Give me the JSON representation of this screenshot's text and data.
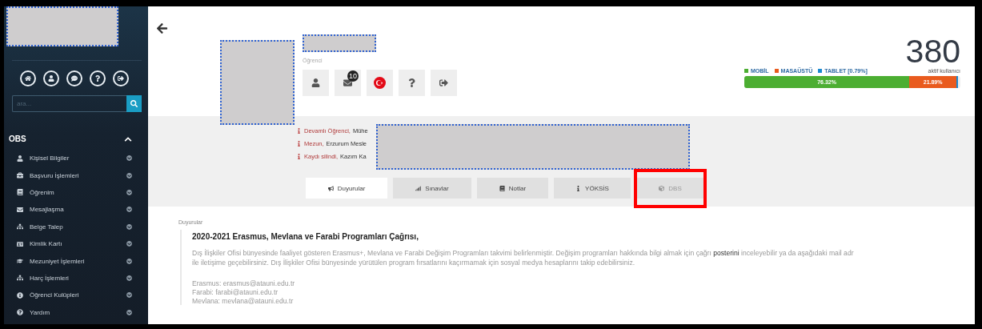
{
  "sidebar": {
    "quick_icons": [
      {
        "kind": "home"
      },
      {
        "kind": "user"
      },
      {
        "kind": "chat"
      },
      {
        "kind": "help"
      },
      {
        "kind": "logout"
      }
    ],
    "search": {
      "placeholder": "ara..."
    },
    "section": {
      "title": "OBS",
      "expanded": true
    },
    "items": [
      {
        "label": "Kişisel Bilgiler",
        "kind": "user"
      },
      {
        "label": "Başvuru İşlemleri",
        "kind": "briefcase"
      },
      {
        "label": "Öğrenim",
        "kind": "book"
      },
      {
        "label": "Mesajlaşma",
        "kind": "envelope"
      },
      {
        "label": "Belge Talep",
        "kind": "sitemap"
      },
      {
        "label": "Kimlik Kartı",
        "kind": "card"
      },
      {
        "label": "Mezuniyet İşlemleri",
        "kind": "cap"
      },
      {
        "label": "Harç İşlemleri",
        "kind": "sitemap"
      },
      {
        "label": "Öğrenci Kulüpleri",
        "kind": "info"
      },
      {
        "label": "Yardım",
        "kind": "help"
      }
    ]
  },
  "profile": {
    "role": "Öğrenci",
    "actions": [
      {
        "kind": "user"
      },
      {
        "kind": "mail",
        "badge": "10"
      },
      {
        "kind": "flag"
      },
      {
        "kind": "help"
      },
      {
        "kind": "logout"
      }
    ],
    "statuses": [
      {
        "status": "Devamlı Öğrenci,",
        "detail": "Mühe"
      },
      {
        "status": "Mezun,",
        "detail": "Erzurum Mesle"
      },
      {
        "status": "Kaydı silindi,",
        "detail": "Kazım Ka"
      }
    ]
  },
  "active_users": {
    "count": "380",
    "label": "aktif kullanıcı",
    "segments": [
      {
        "name": "MOBİL",
        "color": "#4cae32",
        "level": 0.7632,
        "reading": "76.32%"
      },
      {
        "name": "MASAÜSTÜ",
        "color": "#e95b1e",
        "level": 0.2189,
        "reading": "21.89%"
      },
      {
        "name": "TABLET [0.79%]",
        "color": "#1b8ad0",
        "level": 0.0079
      }
    ]
  },
  "tabs": [
    {
      "label": "Duyurular",
      "kind": "bullhorn",
      "selected": true,
      "disabled": false,
      "highlighted": false
    },
    {
      "label": "Sınavlar",
      "kind": "chart",
      "selected": false,
      "disabled": false,
      "highlighted": false
    },
    {
      "label": "Notlar",
      "kind": "book",
      "selected": false,
      "disabled": false,
      "highlighted": false
    },
    {
      "label": "YÖKSİS",
      "kind": "info",
      "selected": false,
      "disabled": false,
      "highlighted": false
    },
    {
      "label": "DBS",
      "kind": "cube",
      "selected": false,
      "disabled": true,
      "highlighted": true
    }
  ],
  "announcements": {
    "heading": "Duyurular",
    "title": "2020-2021 Erasmus, Mevlana ve Farabi Programları Çağrısı,",
    "lines": [
      {
        "before": "Dış İlişkiler Ofisi bünyesinde faaliyet gösteren Erasmus+, Mevlana ve Farabi Değişim Programları takvimi belirlenmiştir. Değişim programları hakkında bilgi almak için çağrı",
        "link": "posterini",
        "after": "inceleyebilir ya da aşağıdaki mail adr"
      },
      {
        "before": "ile iletişime geçebilirsiniz. Dış İlişkiler Ofisi bünyesinde yürütülen program fırsatlarını kaçırmamak için sosyal medya hesaplarını takip edebilirsiniz."
      }
    ],
    "contacts": [
      "Erasmus: erasmus@atauni.edu.tr",
      "Farabi: farabi@atauni.edu.tr",
      "Mevlana: mevlana@atauni.edu.tr"
    ]
  }
}
